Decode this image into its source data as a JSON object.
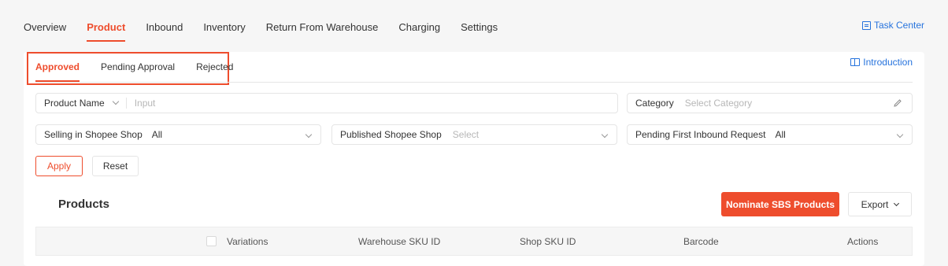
{
  "topnav": {
    "items": [
      "Overview",
      "Product",
      "Inbound",
      "Inventory",
      "Return From Warehouse",
      "Charging",
      "Settings"
    ],
    "active_index": 1,
    "task_center": "Task Center"
  },
  "subtabs": {
    "items": [
      "Approved",
      "Pending Approval",
      "Rejected"
    ],
    "active_index": 0,
    "introduction": "Introduction"
  },
  "filters": {
    "product_name": {
      "label": "Product Name",
      "placeholder": "Input"
    },
    "category": {
      "label": "Category",
      "placeholder": "Select Category"
    },
    "selling_in_shop": {
      "label": "Selling in Shopee Shop",
      "value": "All"
    },
    "published_shop": {
      "label": "Published Shopee Shop",
      "placeholder": "Select"
    },
    "pending_inbound": {
      "label": "Pending First Inbound Request",
      "value": "All"
    }
  },
  "actions": {
    "apply": "Apply",
    "reset": "Reset"
  },
  "products": {
    "title": "Products",
    "nominate": "Nominate SBS Products",
    "export": "Export"
  },
  "table": {
    "columns": [
      "Variations",
      "Warehouse SKU ID",
      "Shop SKU ID",
      "Barcode",
      "Actions"
    ]
  },
  "colors": {
    "accent": "#ee4d2d",
    "link": "#2673dd"
  }
}
